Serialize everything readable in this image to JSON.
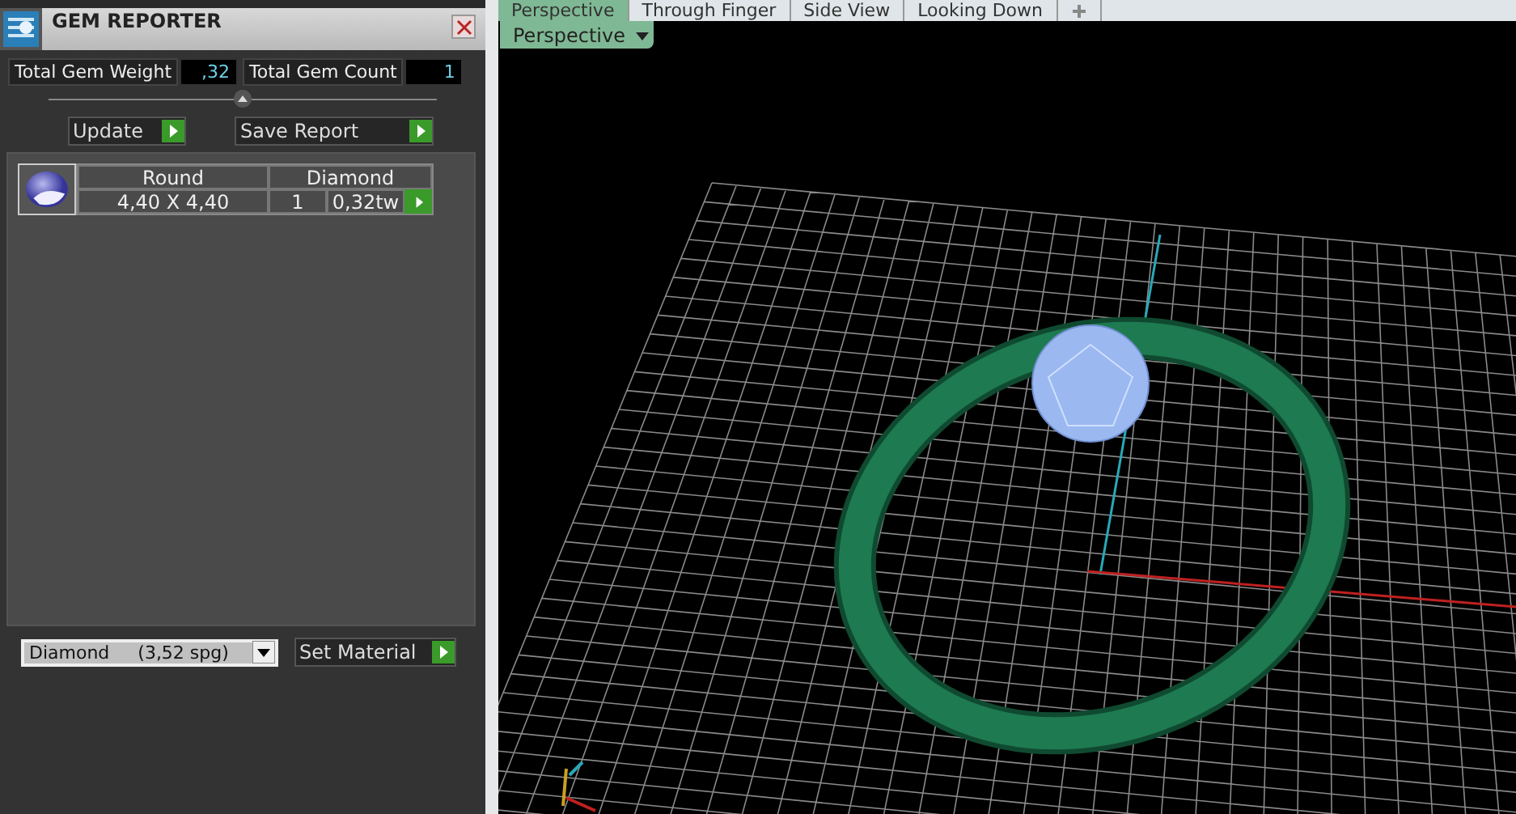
{
  "panel": {
    "title": "GEM REPORTER",
    "total_weight_label": "Total Gem Weight",
    "total_weight": ",32",
    "total_count_label": "Total Gem Count",
    "total_count": "1",
    "buttons": [
      "Update",
      "Save Report"
    ],
    "gems": [
      {
        "shape": "Round",
        "material": "Diamond",
        "size": "4,40 X 4,40",
        "count": "1",
        "weight": "0,32tw"
      }
    ],
    "material_select": "Diamond     (3,52 spg)",
    "set_material_button": "Set Material"
  },
  "view_tabs": [
    {
      "label": "Perspective",
      "selected": true
    },
    {
      "label": "Through Finger",
      "selected": false
    },
    {
      "label": "Side View",
      "selected": false
    },
    {
      "label": "Looking Down",
      "selected": false
    }
  ],
  "view_dropdown": "Perspective"
}
